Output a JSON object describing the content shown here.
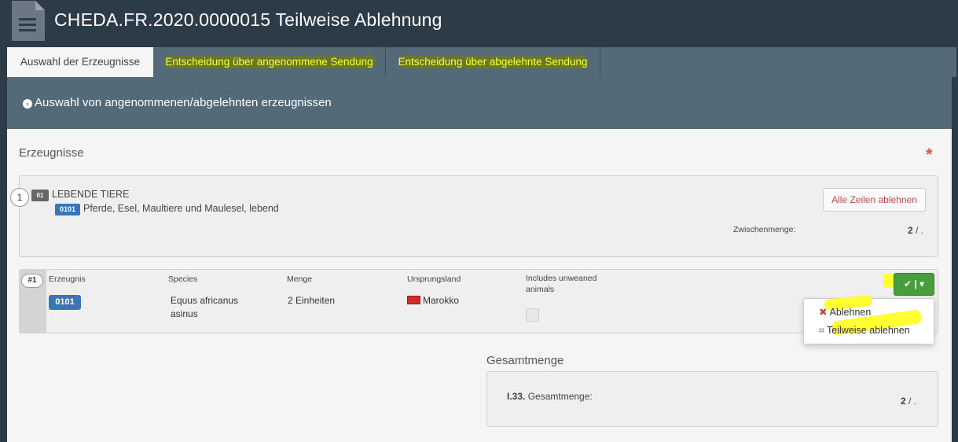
{
  "header": {
    "title": "CHEDA.FR.2020.0000015 Teilweise Ablehnung",
    "icon": "document-icon"
  },
  "tabs": [
    {
      "label": "Auswahl der Erzeugnisse",
      "active": true
    },
    {
      "label": "Entscheidung über angenommene Sendung",
      "active": false
    },
    {
      "label": "Entscheidung über abgelehnte Sendung",
      "active": false
    }
  ],
  "section": {
    "title": "Auswahl von angenommenen/abgelehnten erzeugnissen"
  },
  "products": {
    "label": "Erzeugnisse",
    "required_mark": "*",
    "group": {
      "index": "1",
      "code": "01",
      "title": "LEBENDE TIERE",
      "sub_code": "0101",
      "sub_title": "Pferde, Esel, Maultiere und Maulesel, lebend",
      "reject_all_label": "Alle Zeilen ablehnen",
      "subtotal_label": "Zwischenmenge:",
      "subtotal_value": "2",
      "subtotal_suffix": " / ."
    },
    "columns": [
      "Erzeugnis",
      "Species",
      "Menge",
      "Ursprungsland",
      "Includes unweaned animals"
    ],
    "item": {
      "index": "#1",
      "code": "0101",
      "species": "Equus africanus asinus",
      "quantity": "2 Einheiten",
      "origin": "Marokko",
      "unweaned": false
    },
    "action_button": "✔ | ▾",
    "dropdown": [
      {
        "icon": "close-icon",
        "glyph": "✖",
        "label": "Ablehnen"
      },
      {
        "icon": "crop-icon",
        "glyph": "⌗",
        "label": "Teilweise ablehnen"
      }
    ]
  },
  "total": {
    "label": "Gesamtmenge",
    "key_code": "I.33.",
    "key_label": " Gesamtmenge:",
    "value": "2",
    "suffix": " / ."
  },
  "colors": {
    "dark_bg": "#2b3b48",
    "slate": "#546a78",
    "highlight": "#ffff33",
    "success": "#4a9d3c",
    "danger": "#b94a48",
    "badge_blue": "#3a76b5"
  }
}
